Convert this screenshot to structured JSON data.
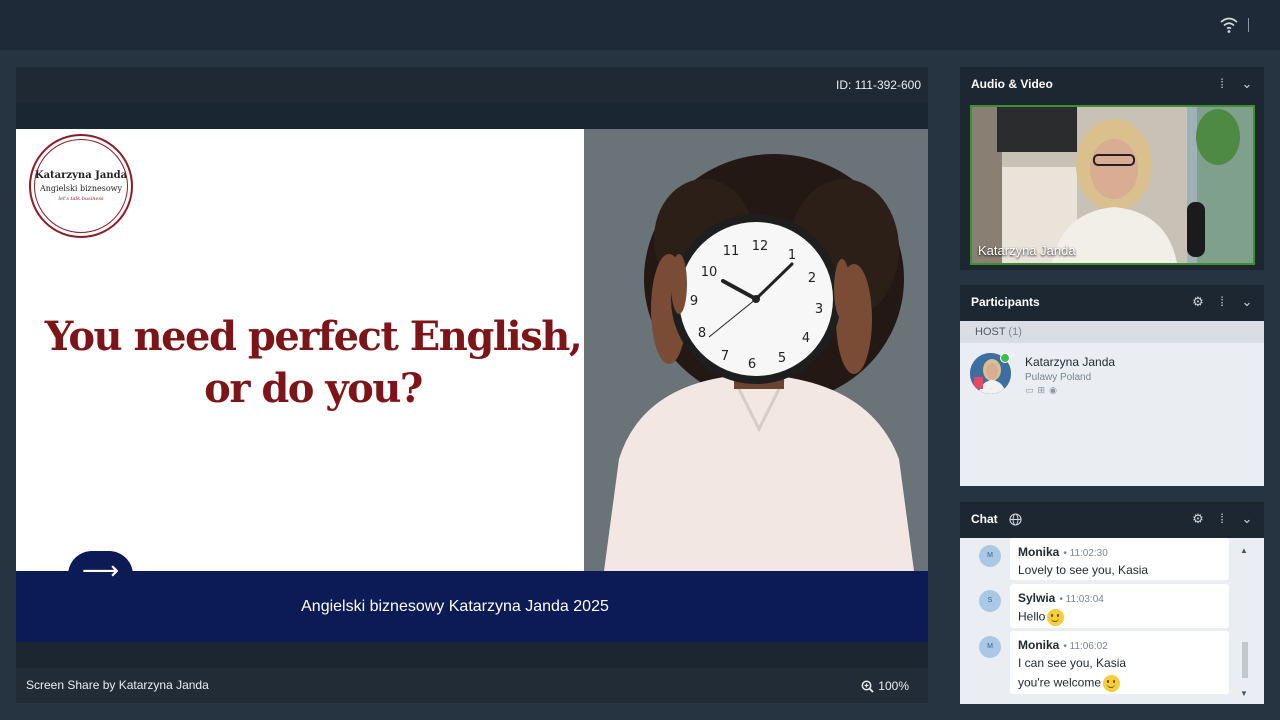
{
  "topbar": {
    "wifi_icon": "wifi-icon"
  },
  "share": {
    "meeting_id": "ID: 111-392-600",
    "caption": "Screen Share by Katarzyna Janda",
    "zoom_level": "100%",
    "slide": {
      "logo_name": "Katarzyna Janda",
      "logo_sub": "Angielski biznesowy",
      "logo_tag": "let's talk business",
      "headline_line1": "You need perfect English,",
      "headline_line2": "or do you?",
      "footer": "Angielski biznesowy Katarzyna Janda 2025",
      "arrow": "⟶"
    }
  },
  "audio_video": {
    "title": "Audio & Video",
    "speaker_name": "Katarzyna Janda"
  },
  "participants": {
    "title": "Participants",
    "host_label": "HOST",
    "host_count": "(1)",
    "list": [
      {
        "name": "Katarzyna Janda",
        "location": "Pulawy Poland"
      }
    ]
  },
  "chat": {
    "title": "Chat",
    "messages": [
      {
        "initial": "M",
        "name": "Monika",
        "time": "11:02:30",
        "lines": [
          "Lovely to see you, Kasia"
        ]
      },
      {
        "initial": "S",
        "name": "Sylwia",
        "time": "11:03:04",
        "lines": [
          "Hello"
        ]
      },
      {
        "initial": "M",
        "name": "Monika",
        "time": "11:06:02",
        "lines": [
          "I can see you, Kasia",
          "you're welcome"
        ]
      }
    ]
  },
  "colors": {
    "background": "#263341",
    "accent_green": "#3f8f2e",
    "slide_red": "#7d1518",
    "slide_navy": "#0c1a56"
  }
}
